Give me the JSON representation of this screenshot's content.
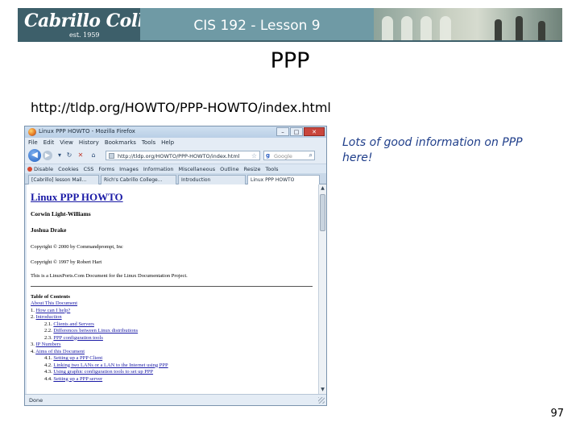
{
  "header": {
    "logo_text": "Cabrillo College",
    "logo_sub": "est. 1959",
    "title": "CIS 192 - Lesson 9"
  },
  "slide": {
    "title": "PPP",
    "url": "http://tldp.org/HOWTO/PPP-HOWTO/index.html",
    "note": "Lots of good information on PPP here!",
    "page_number": "97"
  },
  "browser": {
    "window_title": "Linux PPP HOWTO - Mozilla Firefox",
    "window_buttons": [
      "–",
      "□",
      "✕"
    ],
    "menu": [
      "File",
      "Edit",
      "View",
      "History",
      "Bookmarks",
      "Tools",
      "Help"
    ],
    "address": "http://tldp.org/HOWTO/PPP-HOWTO/index.html",
    "search_placeholder": "Google",
    "bookmarks": [
      "Disable",
      "Cookies",
      "CSS",
      "Forms",
      "Images",
      "Information",
      "Miscellaneous",
      "Outline",
      "Resize",
      "Tools"
    ],
    "tabs": [
      "[Cabrillo] lesson Mail...",
      "Rich's Cabrillo College...",
      "Introduction",
      "Linux PPP HOWTO"
    ],
    "status": "Done"
  },
  "doc": {
    "title": "Linux PPP HOWTO",
    "author1": "Corwin Light-Williams",
    "author2": "Joshua Drake",
    "copyright1": "Copyright © 2000 by Commandprompt, Inc",
    "copyright2": "Copyright © 1997 by Robert Hart",
    "description": "This is a LinuxPorts.Com Document for the Linux Documentation Project.",
    "toc_heading": "Table of Contents",
    "toc": [
      {
        "num": "",
        "text": "About This Document"
      },
      {
        "num": "1. ",
        "text": "How can I help?"
      },
      {
        "num": "2. ",
        "text": "Introduction"
      },
      {
        "num": "2.1. ",
        "text": "Clients and Servers"
      },
      {
        "num": "2.2. ",
        "text": "Differences between Linux distributions"
      },
      {
        "num": "2.3. ",
        "text": "PPP configuration tools"
      },
      {
        "num": "3. ",
        "text": "IP Numbers"
      },
      {
        "num": "4. ",
        "text": "Aims of this Document"
      },
      {
        "num": "4.1. ",
        "text": "Setting up a PPP Client"
      },
      {
        "num": "4.2. ",
        "text": "Linking two LANs or a LAN to the Internet using PPP"
      },
      {
        "num": "4.3. ",
        "text": "Using graphic configuration tools to set up PPP"
      },
      {
        "num": "4.4. ",
        "text": "Setting up a PPP server"
      }
    ]
  }
}
